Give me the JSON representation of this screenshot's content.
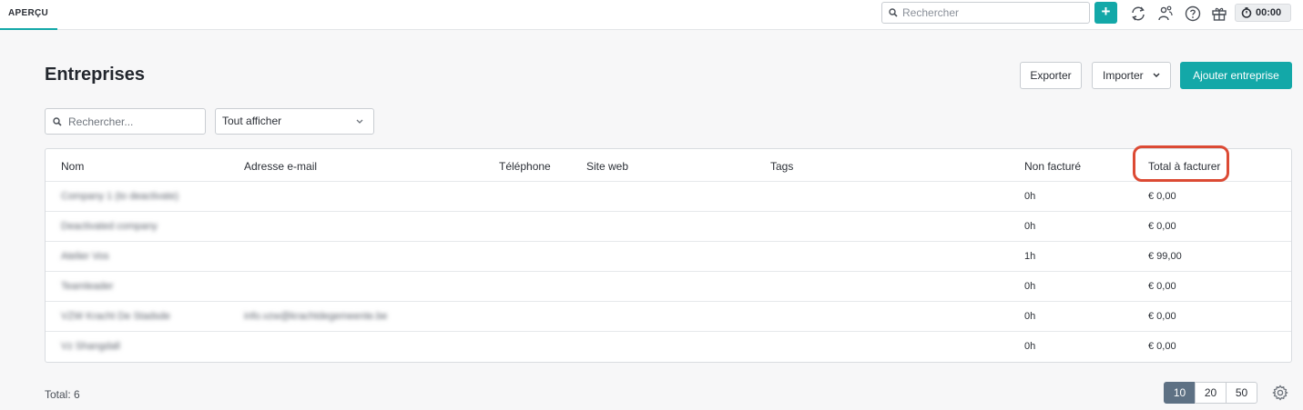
{
  "topbar": {
    "tab_label": "APERÇU",
    "search_placeholder": "Rechercher",
    "add_label": "+",
    "timer": "00:00",
    "icons": [
      "sync-icon",
      "users-icon",
      "help-icon",
      "gift-icon",
      "clock-icon"
    ]
  },
  "page": {
    "title": "Entreprises",
    "export_label": "Exporter",
    "import_label": "Importer",
    "add_company_label": "Ajouter entreprise"
  },
  "filters": {
    "search_placeholder": "Rechercher...",
    "select_value": "Tout afficher"
  },
  "table": {
    "columns": {
      "name": "Nom",
      "email": "Adresse e-mail",
      "phone": "Téléphone",
      "website": "Site web",
      "tags": "Tags",
      "unbilled": "Non facturé",
      "total": "Total à facturer"
    },
    "rows": [
      {
        "name": "Company 1 (to deactivate)",
        "email": "",
        "unbilled": "0h",
        "total": "€ 0,00"
      },
      {
        "name": "Deactivated company",
        "email": "",
        "unbilled": "0h",
        "total": "€ 0,00"
      },
      {
        "name": "Atelier Vos",
        "email": "",
        "unbilled": "1h",
        "total": "€ 99,00"
      },
      {
        "name": "Teamleader",
        "email": "",
        "unbilled": "0h",
        "total": "€ 0,00"
      },
      {
        "name": "VZW Kracht De Stadsde",
        "email": "info.vzw@krachtdegemeente.be",
        "unbilled": "0h",
        "total": "€ 0,00"
      },
      {
        "name": "Vz Shangdall",
        "email": "",
        "unbilled": "0h",
        "total": "€ 0,00"
      }
    ]
  },
  "footer": {
    "total_label": "Total: 6",
    "page_sizes": [
      "10",
      "20",
      "50"
    ],
    "active_page_size": "10"
  },
  "colors": {
    "accent": "#13a8a8",
    "highlight": "#dc4a34",
    "pager_active": "#5e7184"
  }
}
